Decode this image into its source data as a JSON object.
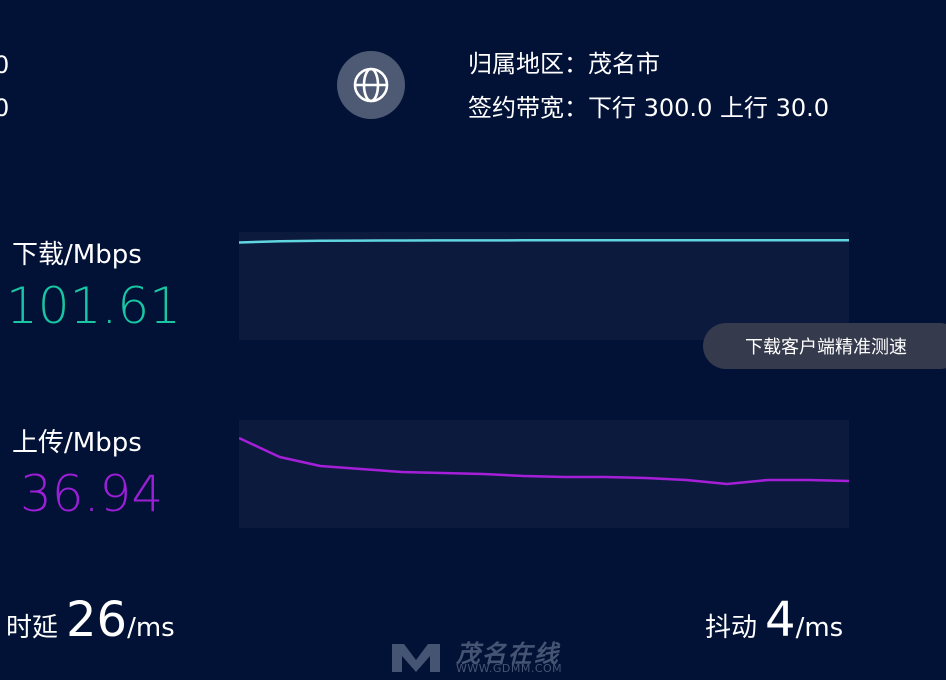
{
  "edge": {
    "digit1": "0",
    "digit2": "0"
  },
  "header": {
    "location_label": "归属地区：",
    "location_value": "茂名市",
    "bandwidth_label": "签约带宽：",
    "bandwidth_value": "下行 300.0 上行 30.0"
  },
  "download": {
    "label": "下载/Mbps",
    "value": "101.61",
    "color": "#19c6a3",
    "line_color": "#5fd6e0"
  },
  "upload": {
    "label": "上传/Mbps",
    "value": "36.94",
    "color": "#9a1fd6",
    "line_color": "#a51fd8"
  },
  "client_button": {
    "label": "下载客户端精准测速"
  },
  "latency": {
    "label": "时延",
    "value": "26",
    "unit": "/ms"
  },
  "jitter": {
    "label": "抖动",
    "value": "4",
    "unit": "/ms"
  },
  "watermark": {
    "brand": "茂名在线",
    "url": "WWW.GDMM.COM"
  },
  "chart_data": [
    {
      "type": "line",
      "name": "download",
      "values": [
        97.5,
        98.8,
        99.2,
        99.4,
        99.5,
        99.6,
        99.6,
        99.7,
        99.7,
        99.7,
        99.8,
        99.8,
        99.8,
        99.8,
        99.8,
        99.8
      ],
      "ylim": [
        0,
        108
      ]
    },
    {
      "type": "line",
      "name": "upload",
      "values": [
        90,
        71,
        62,
        59,
        56,
        55,
        54,
        52,
        51,
        51,
        50,
        48,
        44,
        48,
        48,
        47
      ],
      "ylim": [
        0,
        108
      ]
    }
  ]
}
